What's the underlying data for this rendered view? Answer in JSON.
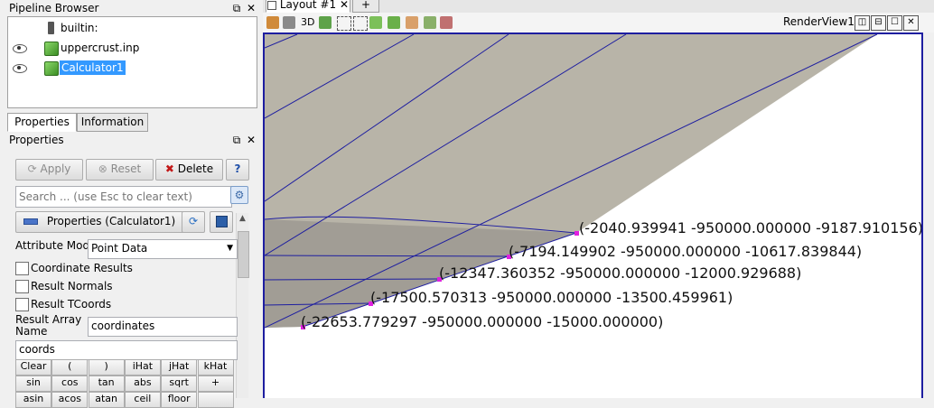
{
  "pipeline": {
    "title": "Pipeline Browser",
    "items": [
      {
        "label": "builtin:"
      },
      {
        "label": "uppercrust.inp"
      },
      {
        "label": "Calculator1"
      }
    ]
  },
  "tabs": [
    {
      "label": "Properties"
    },
    {
      "label": "Information"
    }
  ],
  "properties": {
    "title": "Properties",
    "apply": "Apply",
    "reset": "Reset",
    "delete": "Delete",
    "help": "?",
    "search_placeholder": "Search ... (use Esc to clear text)",
    "section_label": "Properties (Calculator1)",
    "attribute_mode_label": "Attribute Mode",
    "attribute_mode_value": "Point Data",
    "coordinate_results": "Coordinate Results",
    "result_normals": "Result Normals",
    "result_tcoords": "Result TCoords",
    "result_array_name_label": "Result Array Name",
    "result_array_name_value": "coordinates",
    "expression": "coords",
    "calc_row1": [
      "Clear",
      "(",
      ")",
      "iHat",
      "jHat",
      "kHat"
    ],
    "calc_row2": [
      "sin",
      "cos",
      "tan",
      "abs",
      "sqrt",
      "+"
    ],
    "calc_row3": [
      "asin",
      "acos",
      "atan",
      "ceil",
      "floor",
      ""
    ]
  },
  "layout_tabs": [
    {
      "label": "Layout #1"
    },
    {
      "label": "+"
    }
  ],
  "render_view": {
    "title": "RenderView1",
    "toolbar_3d": "3D",
    "points": [
      {
        "label": "(-2040.939941 -950000.000000 -9187.910156)"
      },
      {
        "label": "(-7194.149902 -950000.000000 -10617.839844)"
      },
      {
        "label": "(-12347.360352 -950000.000000 -12000.929688)"
      },
      {
        "label": "(-17500.570313 -950000.000000 -13500.459961)"
      },
      {
        "label": "(-22653.779297 -950000.000000 -15000.000000)"
      }
    ]
  },
  "colors": {
    "mesh": "#b8b4a8",
    "mesh_dark": "#a19d95",
    "edge": "#1e1ea0",
    "point": "#e020e0",
    "selection": "#3399ff"
  }
}
